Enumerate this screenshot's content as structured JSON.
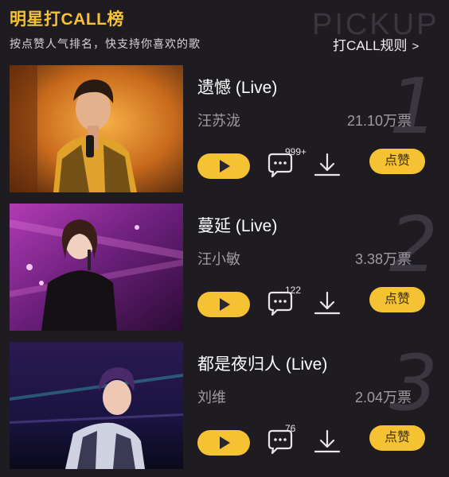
{
  "header": {
    "title": "明星打CALL榜",
    "subtitle": "按点赞人气排名，快支持你喜欢的歌",
    "watermark": "PICKUP",
    "rules_link": "打CALL规则",
    "rules_arrow": ">"
  },
  "songs": [
    {
      "rank": "1",
      "title": "遗憾 (Live)",
      "artist": "汪苏泷",
      "votes": "21.10万票",
      "comment_count": "999+",
      "like_label": "点赞"
    },
    {
      "rank": "2",
      "title": "蔓延 (Live)",
      "artist": "汪小敏",
      "votes": "3.38万票",
      "comment_count": "122",
      "like_label": "点赞"
    },
    {
      "rank": "3",
      "title": "都是夜归人 (Live)",
      "artist": "刘维",
      "votes": "2.04万票",
      "comment_count": "76",
      "like_label": "点赞"
    }
  ],
  "colors": {
    "background": "#1f1c21",
    "accent": "#f4c233",
    "text_secondary": "#9e9ba2"
  }
}
